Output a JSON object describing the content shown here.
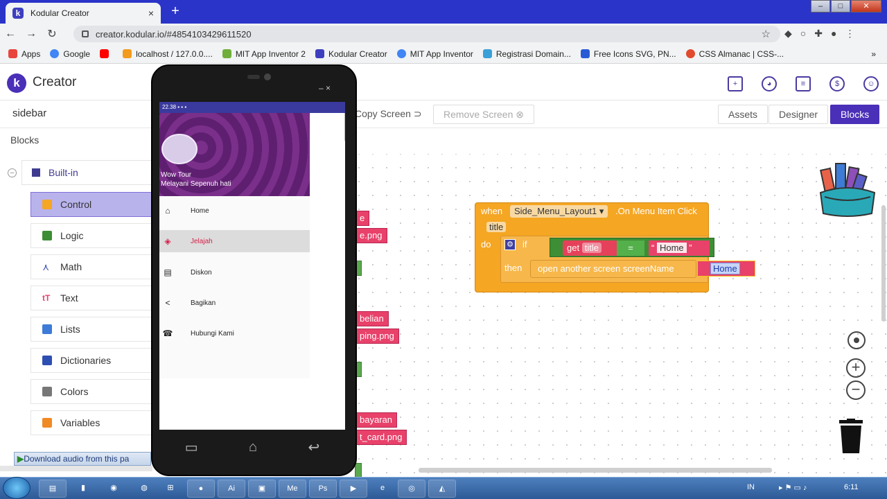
{
  "browser": {
    "tab_title": "Kodular Creator",
    "tab_close": "×",
    "new_tab": "+",
    "url": "creator.kodular.io/#4854103429611520",
    "bookmarks": [
      {
        "label": "Apps",
        "color": "#e8453c"
      },
      {
        "label": "Google",
        "color": "#4285f4"
      },
      {
        "label": "",
        "color": "#ff0000"
      },
      {
        "label": "localhost / 127.0.0....",
        "color": "#f29b1d"
      },
      {
        "label": "MIT App Inventor 2",
        "color": "#6fae3b"
      },
      {
        "label": "Kodular Creator",
        "color": "#3d3fbf"
      },
      {
        "label": "MIT App Inventor",
        "color": "#4285f4"
      },
      {
        "label": "Registrasi Domain...",
        "color": "#3aa0d8"
      },
      {
        "label": "Free Icons SVG, PN...",
        "color": "#2a5bd7"
      },
      {
        "label": "CSS Almanac | CSS-...",
        "color": "#e04a2f"
      }
    ],
    "more_bookmarks": "»"
  },
  "app": {
    "logo_letter": "k",
    "name": "Creator",
    "header_icons": [
      "new-project-icon",
      "palette-icon",
      "library-icon",
      "dollar-icon",
      "account-icon"
    ]
  },
  "project": {
    "screen_name": "sidebar",
    "copy_screen": "Copy Screen",
    "remove_screen": "Remove Screen",
    "assets": "Assets",
    "designer": "Designer",
    "blocks": "Blocks"
  },
  "palette": {
    "title": "Blocks",
    "builtin": "Built-in",
    "items": [
      {
        "label": "Control",
        "color": "#f5a623"
      },
      {
        "label": "Logic",
        "color": "#3d8e34"
      },
      {
        "label": "Math",
        "color": "#3f51b5"
      },
      {
        "label": "Text",
        "color": "#e8416a"
      },
      {
        "label": "Lists",
        "color": "#3d7bd6"
      },
      {
        "label": "Dictionaries",
        "color": "#2e4fb2"
      },
      {
        "label": "Colors",
        "color": "#777777"
      },
      {
        "label": "Variables",
        "color": "#f08a24"
      }
    ]
  },
  "workspace": {
    "side_blocks": [
      "e",
      "e.png",
      "belian",
      "ping.png",
      "bayaran",
      "t_card.png"
    ],
    "event": {
      "when": "when",
      "component": "Side_Menu_Layout1",
      "event_name": ".On Menu Item Click",
      "param": "title",
      "do": "do",
      "if": "if",
      "then": "then",
      "get": "get",
      "get_var": "title",
      "op": "=",
      "compare_text": "Home",
      "action": "open another screen  screenName",
      "screen_text": "Home"
    },
    "zoom_in": "+",
    "zoom_out": "−"
  },
  "phone": {
    "status": "22.38 ▪ ▪ ▪",
    "window_controls": "–  ×",
    "header_line1": "Wow Tour",
    "header_line2": "Melayani Sepenuh hati",
    "menu": [
      {
        "label": "Home",
        "icon": "⌂",
        "selected": false
      },
      {
        "label": "Jelajah",
        "icon": "◈",
        "selected": true
      },
      {
        "label": "Diskon",
        "icon": "▤",
        "selected": false
      },
      {
        "label": "Bagikan",
        "icon": "<",
        "selected": false
      },
      {
        "label": "Hubungi Kami",
        "icon": "☎",
        "selected": false
      }
    ]
  },
  "popup": {
    "download_audio": "Download audio from this pa"
  },
  "taskbar": {
    "lang": "IN",
    "time": "6:11"
  }
}
